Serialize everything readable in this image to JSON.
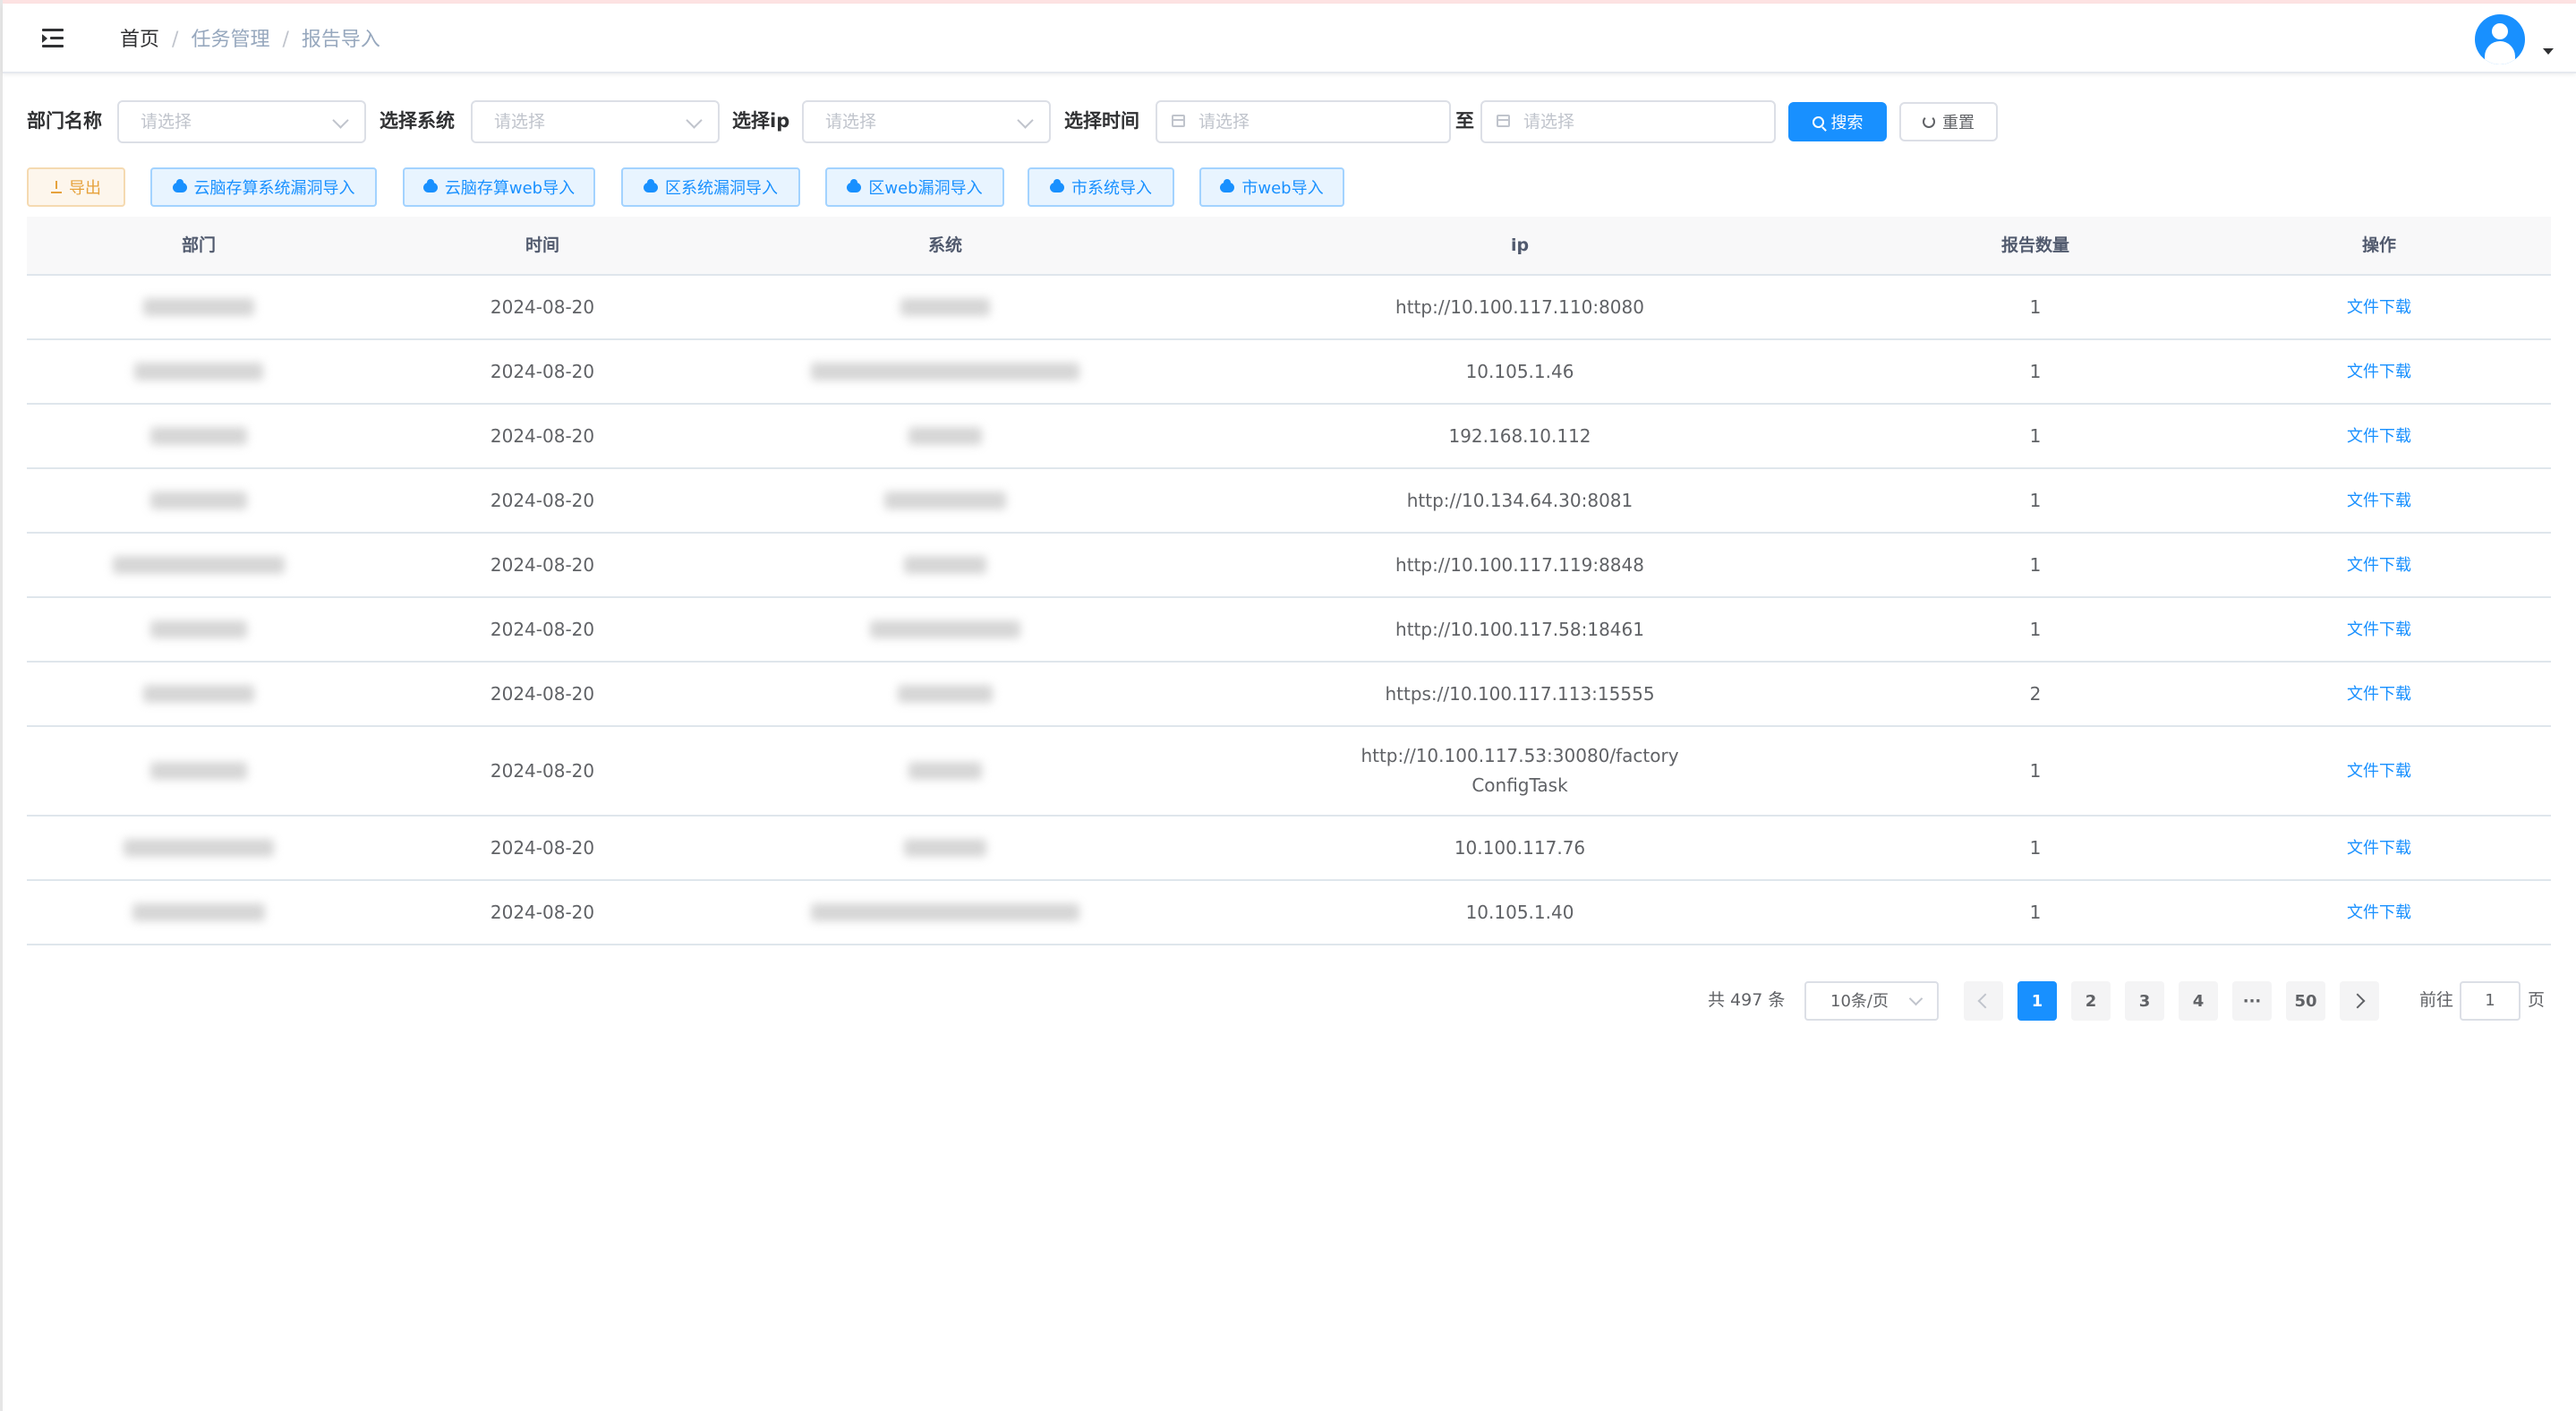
{
  "breadcrumb": [
    "首页",
    "任务管理",
    "报告导入"
  ],
  "filters": {
    "dept_label": "部门名称",
    "system_label": "选择系统",
    "ip_label": "选择ip",
    "time_label": "选择时间",
    "to_label": "至",
    "placeholder": "请选择",
    "search_label": "搜索",
    "reset_label": "重置"
  },
  "actions": {
    "export": "导出",
    "imports": [
      "云脑存算系统漏洞导入",
      "云脑存算web导入",
      "区系统漏洞导入",
      "区web漏洞导入",
      "市系统导入",
      "市web导入"
    ]
  },
  "table": {
    "headers": [
      "部门",
      "时间",
      "系统",
      "ip",
      "报告数量",
      "操作"
    ],
    "rows": [
      {
        "date": "2024-08-20",
        "ip": "http://10.100.117.110:8080",
        "count": "1",
        "op": "文件下载"
      },
      {
        "date": "2024-08-20",
        "ip": "10.105.1.46",
        "count": "1",
        "op": "文件下载"
      },
      {
        "date": "2024-08-20",
        "ip": "192.168.10.112",
        "count": "1",
        "op": "文件下载"
      },
      {
        "date": "2024-08-20",
        "ip": "http://10.134.64.30:8081",
        "count": "1",
        "op": "文件下载"
      },
      {
        "date": "2024-08-20",
        "ip": "http://10.100.117.119:8848",
        "count": "1",
        "op": "文件下载"
      },
      {
        "date": "2024-08-20",
        "ip": "http://10.100.117.58:18461",
        "count": "1",
        "op": "文件下载"
      },
      {
        "date": "2024-08-20",
        "ip": "https://10.100.117.113:15555",
        "count": "2",
        "op": "文件下载"
      },
      {
        "date": "2024-08-20",
        "ip": "http://10.100.117.53:30080/factoryConfigTask",
        "count": "1",
        "op": "文件下载"
      },
      {
        "date": "2024-08-20",
        "ip": "10.100.117.76",
        "count": "1",
        "op": "文件下载"
      },
      {
        "date": "2024-08-20",
        "ip": "10.105.1.40",
        "count": "1",
        "op": "文件下载"
      }
    ]
  },
  "pagination": {
    "total": "共 497 条",
    "page_size": "10条/页",
    "pages": [
      "1",
      "2",
      "3",
      "4",
      "···",
      "50"
    ],
    "current": "1",
    "goto_prefix": "前往",
    "goto_value": "1",
    "goto_suffix": "页"
  },
  "colors": {
    "primary": "#1890ff",
    "warning": "#e6a23c"
  },
  "icons": [
    "hamburger-icon",
    "user-avatar-icon",
    "chevron-down-icon",
    "calendar-icon",
    "search-icon",
    "refresh-icon",
    "download-icon",
    "cloud-upload-icon",
    "chevron-left-icon",
    "chevron-right-icon"
  ]
}
